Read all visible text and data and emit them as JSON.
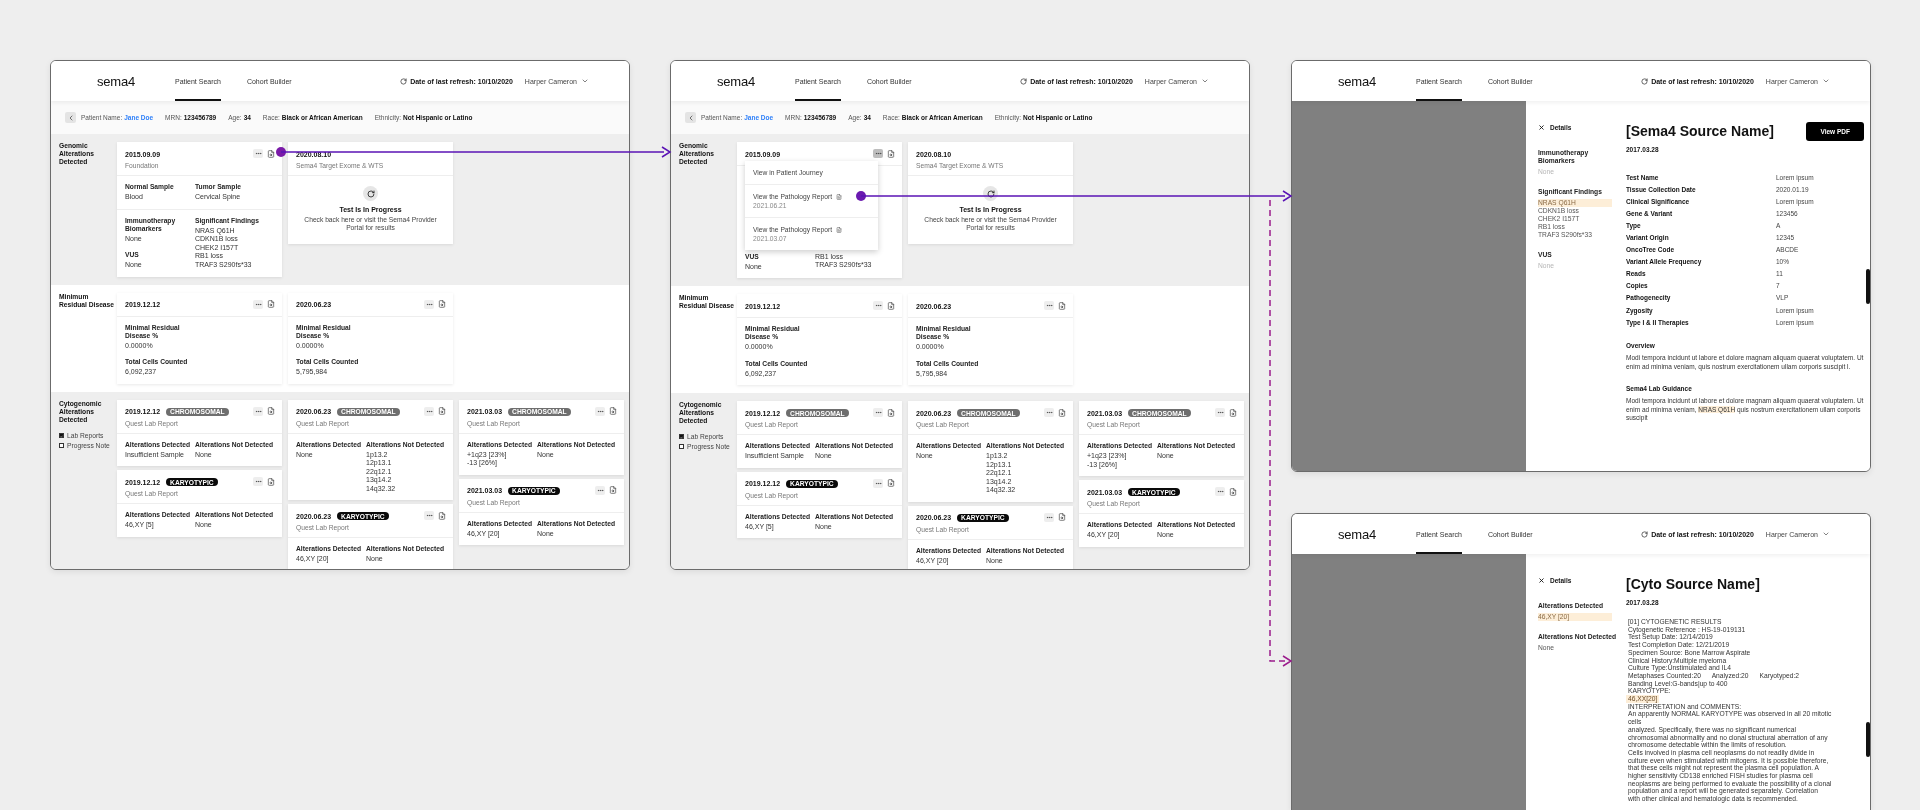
{
  "screens": [
    {
      "kind": "timeline",
      "header": {
        "logo": "sema4",
        "tabs": [
          {
            "label": "Patient Search",
            "selected": true
          },
          {
            "label": "Cohort Builder",
            "selected": false
          }
        ],
        "refresh": "Date of last refresh: 10/10/2020",
        "user": "Harper Cameron"
      },
      "patient": {
        "fields": [
          {
            "label": "Patient Name:",
            "value": "Jane Doe",
            "link": true
          },
          {
            "label": "MRN:",
            "value": "123456789",
            "link": false
          },
          {
            "label": "Age:",
            "value": "34",
            "link": false
          },
          {
            "label": "Race:",
            "value": "Black or African American",
            "link": false
          },
          {
            "label": "Ethnicity:",
            "value": "Not Hispanic or Latino",
            "link": false
          }
        ]
      },
      "sections": [
        {
          "title": "Genomic Alterations Detected",
          "shaded": true,
          "columns": [
            [
              {
                "kind": "report",
                "date": "2015.09.09",
                "source": "Foundation",
                "rows": [
                  {
                    "columns": [
                      [
                        {
                          "label": "Normal Sample",
                          "values": [
                            "Blood"
                          ]
                        }
                      ],
                      [
                        {
                          "label": "Tumor Sample",
                          "values": [
                            "Cervical Spine"
                          ]
                        }
                      ]
                    ]
                  },
                  {
                    "columns": [
                      [
                        {
                          "label": "Immunotherapy Biomarkers",
                          "values": [
                            "None"
                          ]
                        },
                        {
                          "label": "VUS",
                          "values": [
                            "None"
                          ]
                        }
                      ],
                      [
                        {
                          "label": "Significant Findings",
                          "values": [
                            "NRAS Q61H",
                            "CDKN1B loss",
                            "CHEK2 I157T",
                            "RB1 loss",
                            "TRAF3 S290fs*33"
                          ]
                        }
                      ]
                    ]
                  }
                ]
              }
            ],
            [
              {
                "kind": "pending",
                "date": "2020.08.10",
                "source": "Sema4 Target Exome & WTS",
                "title": "Test Is In Progress",
                "message": "Check back here or visit the Sema4 Provider Portal for results"
              }
            ]
          ]
        },
        {
          "title": "Minimum Residual Disease",
          "shaded": false,
          "columns": [
            [
              {
                "kind": "report",
                "date": "2019.12.12",
                "rows": [
                  {
                    "columns": [
                      [
                        {
                          "label": "Minimal Residual Disease %",
                          "values": [
                            "0.0000%"
                          ]
                        },
                        {
                          "label": "Total Cells Counted",
                          "values": [
                            "6,092,237"
                          ]
                        }
                      ]
                    ]
                  }
                ]
              }
            ],
            [
              {
                "kind": "report",
                "date": "2020.06.23",
                "rows": [
                  {
                    "columns": [
                      [
                        {
                          "label": "Minimal Residual Disease %",
                          "values": [
                            "0.0000%"
                          ]
                        },
                        {
                          "label": "Total Cells Counted",
                          "values": [
                            "5,795,984"
                          ]
                        }
                      ]
                    ]
                  }
                ]
              }
            ]
          ]
        },
        {
          "title": "Cytogenomic Alterations Detected",
          "shaded": true,
          "filters": [
            {
              "label": "Lab Reports",
              "checked": true
            },
            {
              "label": "Progress Note",
              "checked": false
            }
          ],
          "columns": [
            [
              {
                "kind": "report",
                "date": "2019.12.12",
                "tag": {
                  "label": "CHROMOSOMAL",
                  "kind": "chromosomal"
                },
                "source": "Quest Lab Report",
                "rows": [
                  {
                    "columns": [
                      [
                        {
                          "label": "Alterations Detected",
                          "values": [
                            "Insufficient Sample"
                          ]
                        }
                      ],
                      [
                        {
                          "label": "Alterations Not Detected",
                          "values": [
                            "None"
                          ]
                        }
                      ]
                    ]
                  }
                ]
              },
              {
                "kind": "report",
                "date": "2019.12.12",
                "tag": {
                  "label": "KARYOTYPIC",
                  "kind": "karyotypic"
                },
                "source": "Quest Lab Report",
                "rows": [
                  {
                    "columns": [
                      [
                        {
                          "label": "Alterations Detected",
                          "values": [
                            "46,XY [5]"
                          ]
                        }
                      ],
                      [
                        {
                          "label": "Alterations Not Detected",
                          "values": [
                            "None"
                          ]
                        }
                      ]
                    ]
                  }
                ]
              }
            ],
            [
              {
                "kind": "report",
                "date": "2020.06.23",
                "tag": {
                  "label": "CHROMOSOMAL",
                  "kind": "chromosomal"
                },
                "source": "Quest Lab Report",
                "rows": [
                  {
                    "columns": [
                      [
                        {
                          "label": "Alterations Detected",
                          "values": [
                            "None"
                          ]
                        }
                      ],
                      [
                        {
                          "label": "Alterations Not Detected",
                          "values": [
                            "1p13.2",
                            "12p13.1",
                            "22q12.1",
                            "13q14.2",
                            "14q32.32"
                          ]
                        }
                      ]
                    ]
                  }
                ]
              },
              {
                "kind": "report",
                "date": "2020.06.23",
                "tag": {
                  "label": "KARYOTYPIC",
                  "kind": "karyotypic"
                },
                "source": "Quest Lab Report",
                "rows": [
                  {
                    "columns": [
                      [
                        {
                          "label": "Alterations Detected",
                          "values": [
                            "46,XY [20]"
                          ]
                        }
                      ],
                      [
                        {
                          "label": "Alterations Not Detected",
                          "values": [
                            "None"
                          ]
                        }
                      ]
                    ]
                  }
                ]
              }
            ],
            [
              {
                "kind": "report",
                "date": "2021.03.03",
                "tag": {
                  "label": "CHROMOSOMAL",
                  "kind": "chromosomal"
                },
                "source": "Quest Lab Report",
                "rows": [
                  {
                    "columns": [
                      [
                        {
                          "label": "Alterations Detected",
                          "values": [
                            "+1q23 [23%]",
                            "-13 [26%]"
                          ]
                        }
                      ],
                      [
                        {
                          "label": "Alterations Not Detected",
                          "values": [
                            "None"
                          ]
                        }
                      ]
                    ]
                  }
                ]
              },
              {
                "kind": "report",
                "date": "2021.03.03",
                "tag": {
                  "label": "KARYOTYPIC",
                  "kind": "karyotypic"
                },
                "source": "Quest Lab Report",
                "rows": [
                  {
                    "columns": [
                      [
                        {
                          "label": "Alterations Detected",
                          "values": [
                            "46,XY [20]"
                          ]
                        }
                      ],
                      [
                        {
                          "label": "Alterations Not Detected",
                          "values": [
                            "None"
                          ]
                        }
                      ]
                    ]
                  }
                ]
              }
            ]
          ]
        }
      ]
    },
    {
      "kind": "timeline",
      "header": {
        "logo": "sema4",
        "tabs": [
          {
            "label": "Patient Search",
            "selected": true
          },
          {
            "label": "Cohort Builder",
            "selected": false
          }
        ],
        "refresh": "Date of last refresh: 10/10/2020",
        "user": "Harper Cameron"
      },
      "patient": {
        "fields": [
          {
            "label": "Patient Name:",
            "value": "Jane Doe",
            "link": true
          },
          {
            "label": "MRN:",
            "value": "123456789",
            "link": false
          },
          {
            "label": "Age:",
            "value": "34",
            "link": false
          },
          {
            "label": "Race:",
            "value": "Black or African American",
            "link": false
          },
          {
            "label": "Ethnicity:",
            "value": "Not Hispanic or Latino",
            "link": false
          }
        ]
      },
      "sections": [
        {
          "title": "Genomic Alterations Detected",
          "shaded": true,
          "columns": [
            [
              {
                "kind": "report",
                "date": "2015.09.09",
                "menu": {
                  "items": [
                    {
                      "label": "View in Patient Journey",
                      "kind": "link"
                    },
                    {
                      "label": "View the Pathology Report",
                      "kind": "report",
                      "date": "2021.06.21"
                    },
                    {
                      "label": "View the Pathology Report",
                      "kind": "report",
                      "date": "2021.03.07"
                    }
                  ]
                },
                "rows": [
                  {
                    "columns": [
                      [
                        {
                          "label": "VUS",
                          "values": [
                            "None"
                          ]
                        }
                      ],
                      [
                        {
                          "values": [
                            "RB1 loss",
                            "TRAF3 S290fs*33"
                          ]
                        }
                      ]
                    ]
                  }
                ]
              }
            ],
            [
              {
                "kind": "pending",
                "date": "2020.08.10",
                "source": "Sema4 Target Exome & WTS",
                "title": "Test Is In Progress",
                "message": "Check back here or visit the Sema4 Provider Portal for results"
              }
            ]
          ]
        },
        {
          "title": "Minimum Residual Disease",
          "shaded": false,
          "columns": [
            [
              {
                "kind": "report",
                "date": "2019.12.12",
                "rows": [
                  {
                    "columns": [
                      [
                        {
                          "label": "Minimal Residual Disease %",
                          "values": [
                            "0.0000%"
                          ]
                        },
                        {
                          "label": "Total Cells Counted",
                          "values": [
                            "6,092,237"
                          ]
                        }
                      ]
                    ]
                  }
                ]
              }
            ],
            [
              {
                "kind": "report",
                "date": "2020.06.23",
                "rows": [
                  {
                    "columns": [
                      [
                        {
                          "label": "Minimal Residual Disease %",
                          "values": [
                            "0.0000%"
                          ]
                        },
                        {
                          "label": "Total Cells Counted",
                          "values": [
                            "5,795,984"
                          ]
                        }
                      ]
                    ]
                  }
                ]
              }
            ]
          ]
        },
        {
          "title": "Cytogenomic Alterations Detected",
          "shaded": true,
          "filters": [
            {
              "label": "Lab Reports",
              "checked": true
            },
            {
              "label": "Progress Note",
              "checked": false
            }
          ],
          "columns": [
            [
              {
                "kind": "report",
                "date": "2019.12.12",
                "tag": {
                  "label": "CHROMOSOMAL",
                  "kind": "chromosomal"
                },
                "source": "Quest Lab Report",
                "rows": [
                  {
                    "columns": [
                      [
                        {
                          "label": "Alterations Detected",
                          "values": [
                            "Insufficient Sample"
                          ]
                        }
                      ],
                      [
                        {
                          "label": "Alterations Not Detected",
                          "values": [
                            "None"
                          ]
                        }
                      ]
                    ]
                  }
                ]
              },
              {
                "kind": "report",
                "date": "2019.12.12",
                "tag": {
                  "label": "KARYOTYPIC",
                  "kind": "karyotypic"
                },
                "source": "Quest Lab Report",
                "rows": [
                  {
                    "columns": [
                      [
                        {
                          "label": "Alterations Detected",
                          "values": [
                            "46,XY [5]"
                          ]
                        }
                      ],
                      [
                        {
                          "label": "Alterations Not Detected",
                          "values": [
                            "None"
                          ]
                        }
                      ]
                    ]
                  }
                ]
              }
            ],
            [
              {
                "kind": "report",
                "date": "2020.06.23",
                "tag": {
                  "label": "CHROMOSOMAL",
                  "kind": "chromosomal"
                },
                "source": "Quest Lab Report",
                "rows": [
                  {
                    "columns": [
                      [
                        {
                          "label": "Alterations Detected",
                          "values": [
                            "None"
                          ]
                        }
                      ],
                      [
                        {
                          "label": "Alterations Not Detected",
                          "values": [
                            "1p13.2",
                            "12p13.1",
                            "22q12.1",
                            "13q14.2",
                            "14q32.32"
                          ]
                        }
                      ]
                    ]
                  }
                ]
              },
              {
                "kind": "report",
                "date": "2020.06.23",
                "tag": {
                  "label": "KARYOTYPIC",
                  "kind": "karyotypic"
                },
                "source": "Quest Lab Report",
                "rows": [
                  {
                    "columns": [
                      [
                        {
                          "label": "Alterations Detected",
                          "values": [
                            "46,XY [20]"
                          ]
                        }
                      ],
                      [
                        {
                          "label": "Alterations Not Detected",
                          "values": [
                            "None"
                          ]
                        }
                      ]
                    ]
                  }
                ]
              }
            ],
            [
              {
                "kind": "report",
                "date": "2021.03.03",
                "tag": {
                  "label": "CHROMOSOMAL",
                  "kind": "chromosomal"
                },
                "source": "Quest Lab Report",
                "rows": [
                  {
                    "columns": [
                      [
                        {
                          "label": "Alterations Detected",
                          "values": [
                            "+1q23 [23%]",
                            "-13 [26%]"
                          ]
                        }
                      ],
                      [
                        {
                          "label": "Alterations Not Detected",
                          "values": [
                            "None"
                          ]
                        }
                      ]
                    ]
                  }
                ]
              },
              {
                "kind": "report",
                "date": "2021.03.03",
                "tag": {
                  "label": "KARYOTYPIC",
                  "kind": "karyotypic"
                },
                "source": "Quest Lab Report",
                "rows": [
                  {
                    "columns": [
                      [
                        {
                          "label": "Alterations Detected",
                          "values": [
                            "46,XY [20]"
                          ]
                        }
                      ],
                      [
                        {
                          "label": "Alterations Not Detected",
                          "values": [
                            "None"
                          ]
                        }
                      ]
                    ]
                  }
                ]
              }
            ]
          ]
        }
      ]
    },
    {
      "kind": "detail",
      "header": {
        "logo": "sema4",
        "tabs": [
          {
            "label": "Patient Search",
            "selected": true
          },
          {
            "label": "Cohort Builder",
            "selected": false
          }
        ],
        "refresh": "Date of last refresh: 10/10/2020",
        "user": "Harper Cameron"
      },
      "panel": {
        "close_label": "Details",
        "fields": [
          {
            "label": "Immunotherapy Biomarkers",
            "values": [
              {
                "text": "None",
                "highlighted": false,
                "greyed": true
              }
            ]
          },
          {
            "label": "Significant Findings",
            "values": [
              {
                "text": "NRAS Q61H",
                "highlighted": true,
                "greyed": false
              },
              {
                "text": "CDKN1B loss",
                "highlighted": false,
                "greyed": false
              },
              {
                "text": "CHEK2 I157T",
                "highlighted": false,
                "greyed": false
              },
              {
                "text": "RB1 loss",
                "highlighted": false,
                "greyed": false
              },
              {
                "text": "TRAF3 S290fs*33",
                "highlighted": false,
                "greyed": false
              }
            ]
          },
          {
            "label": "VUS",
            "values": [
              {
                "text": "None",
                "highlighted": false,
                "greyed": true
              }
            ]
          }
        ]
      },
      "main": {
        "title": "[Sema4 Source Name]",
        "button": "View PDF",
        "date": "2017.03.28",
        "table": [
          {
            "label": "Test Name",
            "value": "Lorem ipsum"
          },
          {
            "label": "Tissue Collection Date",
            "value": "2020.01.19"
          },
          {
            "label": "Clinical Significance",
            "value": "Lorem ipsum"
          },
          {
            "label": "Gene & Variant",
            "value": "123456"
          },
          {
            "label": "Type",
            "value": "A"
          },
          {
            "label": "Variant Origin",
            "value": "12345"
          },
          {
            "label": "OncoTree Code",
            "value": "ABCDE"
          },
          {
            "label": "Variant Allele Frequency",
            "value": "10%"
          },
          {
            "label": "Reads",
            "value": "11"
          },
          {
            "label": "Copies",
            "value": "7"
          },
          {
            "label": "Pathogenecity",
            "value": "VLP"
          },
          {
            "label": "Zygosity",
            "value": "Lorem ipsum"
          },
          {
            "label": "Type I & II Therapies",
            "value": "Lorem ipsum"
          }
        ],
        "notes": [
          {
            "heading": "Overview",
            "parts": [
              {
                "text": "Modi tempora incidunt ut labore et dolore magnam aliquam quaerat voluptatem. Ut enim ad minima veniam, quis nostrum exercitationem ullam corporis suscipit l.",
                "highlighted": false
              }
            ]
          },
          {
            "heading": "Sema4 Lab Guidance",
            "parts": [
              {
                "text": "Modi tempora incidunt ut labore et dolore magnam aliquam quaerat voluptatem. Ut enim ad minima veniam, ",
                "highlighted": false
              },
              {
                "text": "NRAS Q61H",
                "highlighted": true
              },
              {
                "text": " quis nostrum exercitationem ullam corporis suscipit",
                "highlighted": false
              }
            ]
          }
        ]
      }
    },
    {
      "kind": "detail",
      "header": {
        "logo": "sema4",
        "tabs": [
          {
            "label": "Patient Search",
            "selected": true
          },
          {
            "label": "Cohort Builder",
            "selected": false
          }
        ],
        "refresh": "Date of last refresh: 10/10/2020",
        "user": "Harper Cameron"
      },
      "panel": {
        "close_label": "Details",
        "fields": [
          {
            "label": "Alterations Detected",
            "values": [
              {
                "text": "46,XY [20]",
                "highlighted": true,
                "greyed": false
              }
            ]
          },
          {
            "label": "Alterations Not Detected",
            "values": [
              {
                "text": "None",
                "highlighted": false,
                "greyed": false
              }
            ]
          }
        ]
      },
      "main": {
        "title": "[Cyto Source Name]",
        "date": "2017.03.28",
        "report": [
          {
            "text": "[01] CYTOGENETIC RESULTS",
            "highlighted": false
          },
          {
            "text": "Cytogenetic Reference : HS-19-019131",
            "highlighted": false
          },
          {
            "text": "Test Setup Date: 12/14/2019",
            "highlighted": false
          },
          {
            "text": "Test Completion Date: 12/21/2019",
            "highlighted": false
          },
          {
            "text": "Specimen Source: Bone Marrow Aspirate",
            "highlighted": false
          },
          {
            "text": "Clinical History:Multiple myeloma",
            "highlighted": false
          },
          {
            "text": "Culture Type:Unstimulated and IL4",
            "highlighted": false
          },
          {
            "text": "Metaphases Counted:20      Analyzed:20      Karyotyped:2",
            "highlighted": false
          },
          {
            "text": "Banding Level:G-bands|up to 400",
            "highlighted": false
          },
          {
            "text": "KARYOTYPE:",
            "highlighted": false
          },
          {
            "text": "46,XX[20]",
            "highlighted": true
          },
          {
            "text": "INTERPRETATION and COMMENTS:",
            "highlighted": false
          },
          {
            "text": "An apparently NORMAL KARYOTYPE was observed in all 20 mitotic",
            "highlighted": false
          },
          {
            "text": "cells",
            "highlighted": false
          },
          {
            "text": "analyzed. Specifically, there was no significant numerical",
            "highlighted": false
          },
          {
            "text": "chromosomal abnormality and no clonal structural aberration of any",
            "highlighted": false
          },
          {
            "text": "chromosome detectable within the limits of resolution.",
            "highlighted": false
          },
          {
            "text": "Cells involved in plasma cell neoplasms do not readily divide in",
            "highlighted": false
          },
          {
            "text": "culture even when stimulated with mitogens. It is possible therefore,",
            "highlighted": false
          },
          {
            "text": "that these cells might not represent the plasma cell population. A",
            "highlighted": false
          },
          {
            "text": "higher sensitivity CD138 enriched FISH studies for plasma cell",
            "highlighted": false
          },
          {
            "text": "neoplasms are being performed to evaluate the possibility of a clonal",
            "highlighted": false
          },
          {
            "text": "population and a report will be generated separately. Correlation",
            "highlighted": false
          },
          {
            "text": "with other clinical and hematologic data is recommended.",
            "highlighted": false
          }
        ]
      }
    }
  ]
}
